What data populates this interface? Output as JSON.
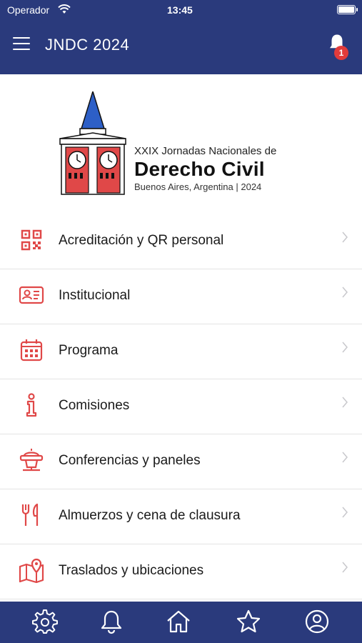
{
  "status_bar": {
    "carrier": "Operador",
    "time": "13:45"
  },
  "header": {
    "title": "JNDC 2024",
    "notification_count": "1"
  },
  "logo": {
    "line1": "XXIX Jornadas Nacionales de",
    "line2": "Derecho Civil",
    "line3": "Buenos Aires, Argentina  |  2024"
  },
  "menu": {
    "items": [
      {
        "label": "Acreditación y QR personal",
        "icon": "qr-code-icon"
      },
      {
        "label": "Institucional",
        "icon": "id-card-icon"
      },
      {
        "label": "Programa",
        "icon": "calendar-icon"
      },
      {
        "label": "Comisiones",
        "icon": "info-icon"
      },
      {
        "label": "Conferencias y paneles",
        "icon": "podium-icon"
      },
      {
        "label": "Almuerzos y cena de clausura",
        "icon": "cutlery-icon"
      },
      {
        "label": "Traslados y ubicaciones",
        "icon": "map-icon"
      }
    ]
  },
  "tabbar": {
    "tabs": [
      "settings-icon",
      "bell-icon",
      "home-icon",
      "star-icon",
      "user-icon"
    ]
  },
  "colors": {
    "primary": "#2a3a7c",
    "accent": "#e23b3b",
    "icon_red": "#e04848"
  }
}
